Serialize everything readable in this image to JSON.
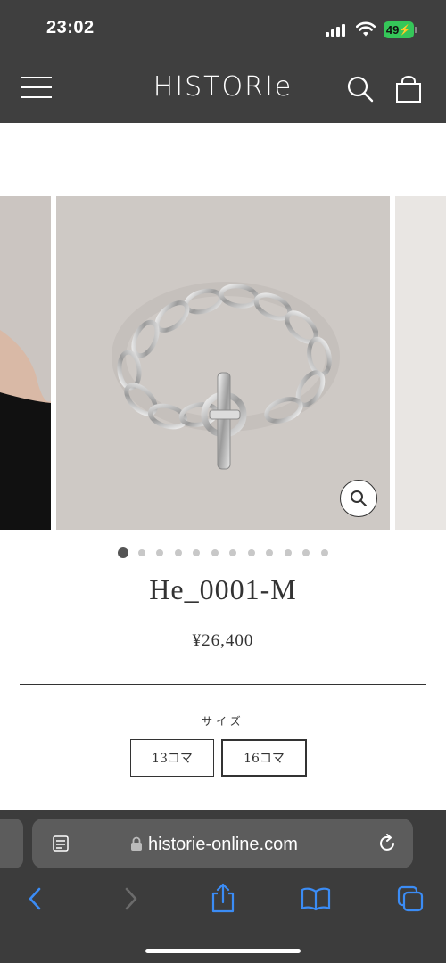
{
  "status": {
    "time": "23:02",
    "battery": "49"
  },
  "header": {
    "brand": "HISTORIe"
  },
  "carousel": {
    "slide_count": 12,
    "active_index": 0
  },
  "product": {
    "title": "He_0001-M",
    "price": "¥26,400"
  },
  "size": {
    "label": "サイズ",
    "options": [
      "13コマ",
      "16コマ"
    ],
    "selected": "16コマ"
  },
  "browser": {
    "url": "historie-online.com"
  },
  "icons": [
    "menu-icon",
    "search-icon",
    "cart-icon",
    "zoom-icon",
    "reader-icon",
    "lock-icon",
    "reload-icon",
    "back-icon",
    "forward-icon",
    "share-icon",
    "bookmarks-icon",
    "tabs-icon"
  ],
  "colors": {
    "header_bg": "#3f3f3f",
    "battery": "#35c759",
    "ios_blue": "#3b8cf5"
  }
}
